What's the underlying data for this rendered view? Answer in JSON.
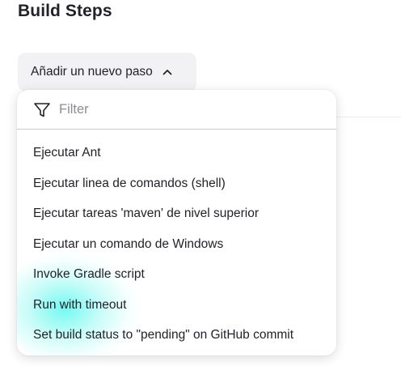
{
  "section": {
    "title": "Build Steps"
  },
  "add_step": {
    "label": "Añadir un nuevo paso",
    "icon": "chevron-up-icon"
  },
  "dropdown": {
    "filter": {
      "placeholder": "Filter",
      "value": "",
      "icon": "filter-icon"
    },
    "items": [
      {
        "label": "Ejecutar Ant"
      },
      {
        "label": "Ejecutar linea de comandos (shell)"
      },
      {
        "label": "Ejecutar tareas 'maven' de nivel superior"
      },
      {
        "label": "Ejecutar un comando de Windows"
      },
      {
        "label": "Invoke Gradle script"
      },
      {
        "label": "Run with timeout"
      },
      {
        "label": "Set build status to \"pending\" on GitHub commit"
      }
    ]
  },
  "colors": {
    "text": "#222228",
    "button_bg": "#f2f2f4",
    "placeholder": "#8c8c94",
    "highlight_glow": "#00f5e6"
  }
}
